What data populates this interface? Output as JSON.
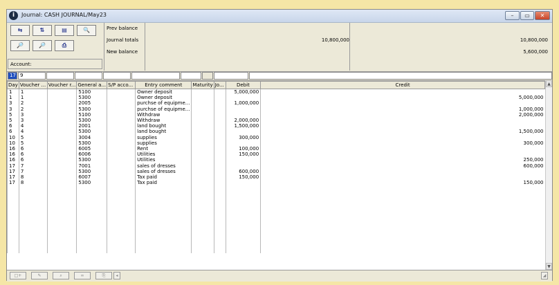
{
  "window": {
    "title": "Journal: CASH JOURNAL/May23",
    "icon": "info-icon",
    "min_label": "–",
    "max_label": "▭",
    "close_label": "✕"
  },
  "toolbar": {
    "buttons": [
      {
        "name": "transfer-icon",
        "glyph": "⇆"
      },
      {
        "name": "split-icon",
        "glyph": "⇅"
      },
      {
        "name": "book-icon",
        "glyph": "▤"
      },
      {
        "name": "search-currency-icon",
        "glyph": "🔍"
      },
      {
        "name": "preview-icon",
        "glyph": "🔎"
      },
      {
        "name": "zoom-icon",
        "glyph": "🔎"
      },
      {
        "name": "print-icon",
        "glyph": "⎙"
      }
    ],
    "account_label": "Account:"
  },
  "summary": {
    "prev_balance_label": "Prev balance",
    "journal_totals_label": "Journal totals",
    "new_balance_label": "New balance",
    "journal_totals_debit": "10,800,000",
    "journal_totals_credit": "10,800,000",
    "new_balance_credit": "5,600,000"
  },
  "filter": {
    "day": "17",
    "voucher": "9"
  },
  "columns": [
    "Day",
    "Voucher ...",
    "Voucher r...",
    "General a...",
    "S/P acco...",
    "Entry comment",
    "Maturity",
    "Jo...",
    "Debit",
    "Credit"
  ],
  "rows": [
    {
      "day": "1",
      "voucher": "1",
      "ga": "5100",
      "comment": "Owner deposit",
      "debit": "5,000,000",
      "credit": ""
    },
    {
      "day": "1",
      "voucher": "1",
      "ga": "5300",
      "comment": "Owner deposit",
      "debit": "",
      "credit": "5,000,000"
    },
    {
      "day": "3",
      "voucher": "2",
      "ga": "2005",
      "comment": "purchse of equipme...",
      "debit": "1,000,000",
      "credit": ""
    },
    {
      "day": "3",
      "voucher": "2",
      "ga": "5300",
      "comment": "purchse of equipme...",
      "debit": "",
      "credit": "1,000,000"
    },
    {
      "day": "5",
      "voucher": "3",
      "ga": "5100",
      "comment": "Withdraw",
      "debit": "",
      "credit": "2,000,000"
    },
    {
      "day": "5",
      "voucher": "3",
      "ga": "5300",
      "comment": "Withdraw",
      "debit": "2,000,000",
      "credit": ""
    },
    {
      "day": "6",
      "voucher": "4",
      "ga": "2001",
      "comment": "land bought",
      "debit": "1,500,000",
      "credit": ""
    },
    {
      "day": "6",
      "voucher": "4",
      "ga": "5300",
      "comment": "land bought",
      "debit": "",
      "credit": "1,500,000"
    },
    {
      "day": "10",
      "voucher": "5",
      "ga": "3004",
      "comment": "supplies",
      "debit": "300,000",
      "credit": ""
    },
    {
      "day": "10",
      "voucher": "5",
      "ga": "5300",
      "comment": "supplies",
      "debit": "",
      "credit": "300,000"
    },
    {
      "day": "16",
      "voucher": "6",
      "ga": "6005",
      "comment": "Rent",
      "debit": "100,000",
      "credit": ""
    },
    {
      "day": "16",
      "voucher": "6",
      "ga": "6006",
      "comment": "Utilities",
      "debit": "150,000",
      "credit": ""
    },
    {
      "day": "16",
      "voucher": "6",
      "ga": "5300",
      "comment": "Utilities",
      "debit": "",
      "credit": "250,000"
    },
    {
      "day": "17",
      "voucher": "7",
      "ga": "7001",
      "comment": "sales of dresses",
      "debit": "",
      "credit": "600,000"
    },
    {
      "day": "17",
      "voucher": "7",
      "ga": "5300",
      "comment": "sales of dresses",
      "debit": "600,000",
      "credit": ""
    },
    {
      "day": "17",
      "voucher": "8",
      "ga": "6007",
      "comment": "Tax paid",
      "debit": "150,000",
      "credit": ""
    },
    {
      "day": "17",
      "voucher": "8",
      "ga": "5300",
      "comment": "Tax paid",
      "debit": "",
      "credit": "150,000"
    }
  ],
  "bottom_buttons": [
    "add-row-icon",
    "edit-icon",
    "zoom-icon",
    "link-icon",
    "attach-icon"
  ],
  "colors": {
    "frame": "#f5e6a6",
    "panel": "#ece9d8",
    "close": "#c8452a",
    "filter_day_bg": "#1f4fbf"
  }
}
